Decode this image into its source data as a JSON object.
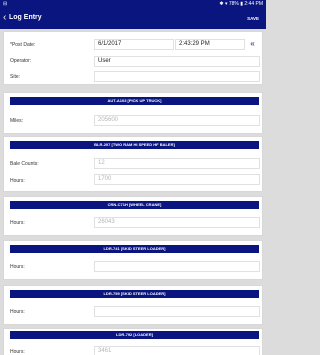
{
  "status_bar": {
    "left": "⊟",
    "right": "✱ ▾ 78% ▮ 2:44 PM"
  },
  "app_bar": {
    "back_icon": "‹",
    "title": "Log Entry",
    "save_label": "SAVE"
  },
  "post_date": {
    "label": "*Post Date:",
    "date": "6/1/2017",
    "time": "2:43:29 PM",
    "nav_icon": "«"
  },
  "operator": {
    "label": "Operator:",
    "value": "User"
  },
  "site": {
    "label": "Site:",
    "value": ""
  },
  "equipment": [
    {
      "title": "AUT-A103 [PICK UP TRUCK]",
      "fields": [
        {
          "label": "Miles:",
          "placeholder": "205600"
        }
      ]
    },
    {
      "title": "BLR-207 [TWO RAM HI SPEED HF BALER]",
      "fields": [
        {
          "label": "Bale Counts:",
          "placeholder": "12"
        },
        {
          "label": "Hours:",
          "placeholder": "1700"
        }
      ]
    },
    {
      "title": "CRN-C71H [WHEEL CRANE]",
      "fields": [
        {
          "label": "Hours:",
          "placeholder": "26043"
        }
      ]
    },
    {
      "title": "LDR-741 [SKID STEER LOADER]",
      "fields": [
        {
          "label": "Hours:",
          "placeholder": ""
        }
      ]
    },
    {
      "title": "LDR-759 [SKID STEER LOADER]",
      "fields": [
        {
          "label": "Hours:",
          "placeholder": ""
        }
      ]
    },
    {
      "title": "LDR-792 [LOADER]",
      "fields": [
        {
          "label": "Hours:",
          "placeholder": "3461"
        }
      ]
    }
  ]
}
